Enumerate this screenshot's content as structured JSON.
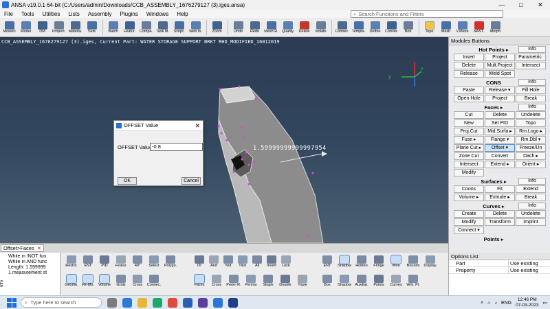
{
  "titlebar": {
    "title": "ANSA v19.0.1 64-bit (C:/Users/admin/Downloads/CCB_ASSEMBLY_1676279127 (3).iges.ansa)",
    "minimize": "—",
    "maximize": "□",
    "close": "✕"
  },
  "menu": [
    "File",
    "Tools",
    "Utilities",
    "Lists",
    "Assembly",
    "Plugins",
    "Windows",
    "Help"
  ],
  "search": {
    "placeholder": "Search Functions and Filters"
  },
  "toolbar": [
    {
      "label": "Model0",
      "name": "model0",
      "icon": "model-icon"
    },
    {
      "label": "Model",
      "name": "model",
      "icon": "model-icon"
    },
    {
      "label": "DM",
      "name": "dm",
      "icon": "dm-icon"
    },
    {
      "label": "Propert.",
      "name": "properties",
      "icon": "properties-icon"
    },
    {
      "label": "Materia.",
      "name": "materials",
      "icon": "materials-icon"
    },
    {
      "label": "Sets",
      "name": "sets",
      "icon": "sets-icon"
    },
    {
      "label": "Batch",
      "name": "batch",
      "icon": "batch-icon"
    },
    {
      "label": "Featur.",
      "name": "features",
      "icon": "features-icon"
    },
    {
      "label": "Compa.",
      "name": "compare",
      "icon": "compare-icon"
    },
    {
      "label": "Task M.",
      "name": "task-manager",
      "icon": "task-icon"
    },
    {
      "label": "Script.",
      "name": "script",
      "icon": "script-icon"
    },
    {
      "label": "Web In.",
      "name": "web-info",
      "icon": "web-icon"
    },
    {
      "label": "Zoom",
      "name": "zoom",
      "icon": "zoom-icon"
    },
    {
      "label": "Undo",
      "name": "undo",
      "icon": "undo-icon"
    },
    {
      "label": "Redo",
      "name": "redo",
      "icon": "redo-icon"
    },
    {
      "label": "Mesh R.",
      "name": "mesh-r",
      "icon": "mesh-icon"
    },
    {
      "label": "Quality",
      "name": "quality",
      "icon": "quality-icon"
    },
    {
      "label": "Delete",
      "name": "delete",
      "icon": "delete-icon"
    },
    {
      "label": "Isolate",
      "name": "isolate",
      "icon": "isolate-icon"
    },
    {
      "label": "Connec.",
      "name": "connections",
      "icon": "connections-icon"
    },
    {
      "label": "Templa.",
      "name": "templates",
      "icon": "templates-icon"
    },
    {
      "label": "Define",
      "name": "define",
      "icon": "define-icon"
    },
    {
      "label": "Conver.",
      "name": "convert",
      "icon": "convert-icon"
    },
    {
      "label": "Bolt",
      "name": "bolt",
      "icon": "bolt-icon"
    },
    {
      "label": "Topo",
      "name": "topo",
      "icon": "topo-icon"
    },
    {
      "label": "Mesh",
      "name": "mesh",
      "icon": "mesh-icon"
    },
    {
      "label": "V.Mesh",
      "name": "vmesh",
      "icon": "vmesh-icon"
    },
    {
      "label": "NAST.",
      "name": "nastran",
      "icon": "nastran-icon"
    },
    {
      "label": "Morph",
      "name": "morph",
      "icon": "morph-icon"
    }
  ],
  "viewport": {
    "header": "CCB_ASSEMBLY_1676279127 (3).iges,  Current Part: WATER STORAGE SUPPORT BRKT RHD_MODIFIED_16012019",
    "measure": "1.59999999999997954"
  },
  "dialog": {
    "title": "OFFSET Value",
    "label": "OFFSET Value",
    "value": "-0.8",
    "ok": "OK",
    "cancel": "Cancel",
    "close": "✕"
  },
  "panel": {
    "title": "Modules Buttons",
    "groups": [
      {
        "head": "Hot Points ▸",
        "info": "Info",
        "rows": [
          [
            "Insert",
            "Project",
            "Parametric."
          ],
          [
            "Delete",
            "Mult.Project",
            "Intersect"
          ],
          [
            "Release",
            "Weld Spot"
          ]
        ]
      },
      {
        "head": "CONS",
        "info": "Info",
        "rows": [
          [
            "Paste",
            "Release ▾",
            "Fill Hole"
          ],
          [
            "Open Hole",
            "Project",
            "Break"
          ]
        ]
      },
      {
        "head": "Faces ▸",
        "info": "Info",
        "rows": [
          [
            "Cut",
            "Delete",
            "Undelete"
          ],
          [
            "New",
            "Set PID",
            "Topo"
          ],
          [
            "Proj.Cut",
            "Mid.Surfa ▸",
            "Rm.Logo ▸"
          ],
          [
            "Fuse ▸",
            "Flange ▾",
            "Rm.Dbl ▾"
          ],
          [
            "Plane Cut ▸",
            "Offset ▾",
            "Freeze/Un"
          ],
          [
            "Zone Cut",
            "Convert",
            "Dach ▸"
          ],
          [
            "Intersect",
            "Extend ▸",
            "Orient ▸"
          ],
          [
            "Modify"
          ]
        ]
      },
      {
        "head": "Surfaces ▸",
        "info": "Info",
        "rows": [
          [
            "Coons",
            "Fit",
            "Extend"
          ],
          [
            "Volume ▸",
            "Extrude ▸",
            "Break"
          ]
        ]
      },
      {
        "head": "Curves ▸",
        "info": "Info",
        "rows": [
          [
            "Create",
            "Delete",
            "Undelete"
          ],
          [
            "Modify",
            "Transform",
            "Imprint"
          ],
          [
            "Connect ▾"
          ]
        ]
      },
      {
        "head": "Points ▸",
        "info": "",
        "rows": []
      }
    ]
  },
  "tabbar": {
    "tab": "Offset>Faces",
    "close": "✕"
  },
  "messages": [
    "While in !NOT fun",
    "While in AND func",
    "Length: 1.599999",
    "1 measurement st"
  ],
  "info_tab": "Info",
  "lower_toolbar": [
    {
      "label": "Restor.",
      "name": "restore"
    },
    {
      "label": "ENT",
      "name": "ent"
    },
    {
      "label": "PID",
      "name": "pid"
    },
    {
      "label": "Featur.",
      "name": "feature-angle"
    },
    {
      "label": "40°",
      "name": "angle"
    },
    {
      "label": "Select",
      "name": "select"
    },
    {
      "label": "Polygo.",
      "name": "polygon"
    },
    {
      "label": "Or",
      "name": "or"
    },
    {
      "label": "And",
      "name": "and"
    },
    {
      "label": "Not",
      "name": "not"
    },
    {
      "label": "!Not",
      "name": "inot"
    },
    {
      "label": "All",
      "name": "all"
    },
    {
      "label": "Invert",
      "name": "invert"
    },
    {
      "label": "Lock",
      "name": "lock"
    },
    {
      "label": "ENT",
      "name": "ent2"
    },
    {
      "label": "Shadow",
      "name": "shadow"
    },
    {
      "label": "Hidden",
      "name": "hidden"
    },
    {
      "label": "Fringe",
      "name": "fringe"
    },
    {
      "label": "Wire",
      "name": "wire"
    },
    {
      "label": "Bounds",
      "name": "bounds"
    },
    {
      "label": "Display.",
      "name": "display"
    },
    {
      "label": "Geome.",
      "name": "geometry"
    },
    {
      "label": "FE-Mo.",
      "name": "fe-model"
    },
    {
      "label": "Volume",
      "name": "volume"
    },
    {
      "label": "Grids",
      "name": "grids"
    },
    {
      "label": "Cross",
      "name": "cross"
    },
    {
      "label": "Connec.",
      "name": "connec"
    },
    {
      "label": "Faces",
      "name": "faces"
    },
    {
      "label": "Cross",
      "name": "cross2"
    },
    {
      "label": "Perim R.",
      "name": "perim-r"
    },
    {
      "label": "Perims",
      "name": "perims"
    },
    {
      "label": "Single",
      "name": "single"
    },
    {
      "label": "Double",
      "name": "double"
    },
    {
      "label": "Triple",
      "name": "triple"
    },
    {
      "label": "Box",
      "name": "box"
    },
    {
      "label": "Shadow",
      "name": "shadow2"
    },
    {
      "label": "Auxiliar.",
      "name": "auxiliary"
    },
    {
      "label": "Points",
      "name": "points"
    },
    {
      "label": "Curves",
      "name": "curves"
    },
    {
      "label": "Wrk. Pl.",
      "name": "work-plane"
    }
  ],
  "options": {
    "title": "Options List",
    "rows": [
      {
        "k": "Part",
        "v": "Use existing"
      },
      {
        "k": "Property",
        "v": "Use existing"
      }
    ]
  },
  "taskbar": {
    "search": "Type here to search",
    "lang": "ENG",
    "time": "12:46 PM",
    "date": "07-03-2023"
  },
  "colors": {
    "viewport_top": "#2b3b52",
    "accent": "#5b8ec7",
    "model_face": "#8c8c8c",
    "hotpoint": "#e040e0"
  }
}
